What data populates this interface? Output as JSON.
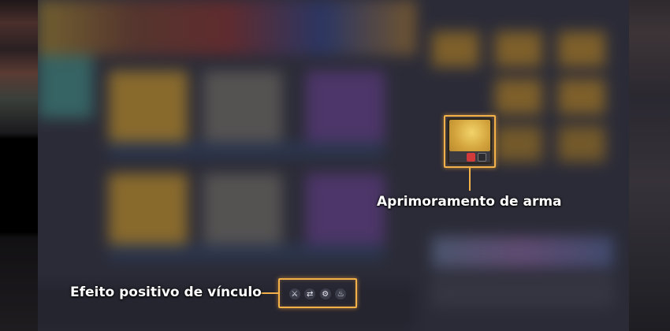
{
  "callouts": {
    "weapon_upgrade": "Aprimoramento de arma",
    "bond_effect": "Efeito positivo de vínculo"
  },
  "icons": {
    "weapon": "weapon-icon",
    "bond": [
      "sword-icon",
      "arrows-icon",
      "gear-icon",
      "flame-icon"
    ]
  },
  "colors": {
    "highlight": "#f3b149",
    "gold_card": "#c99a38",
    "purple_card": "#6d4a94",
    "silver_card": "#7a7670"
  }
}
